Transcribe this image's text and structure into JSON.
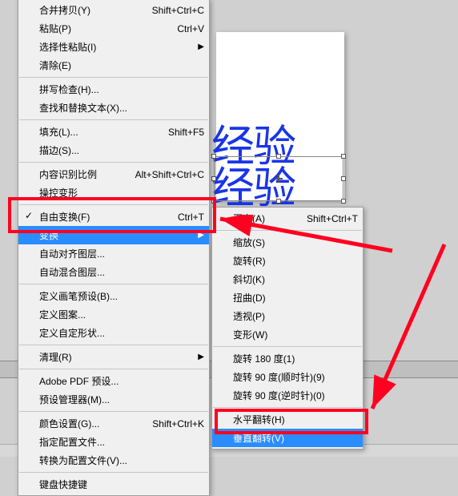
{
  "canvas": {
    "line1": "经验",
    "line2": "经验"
  },
  "menu1": {
    "copy_merge": {
      "label": "合并拷贝(Y)",
      "shortcut": "Shift+Ctrl+C"
    },
    "paste": {
      "label": "粘贴(P)",
      "shortcut": "Ctrl+V"
    },
    "paste_special": {
      "label": "选择性粘贴(I)"
    },
    "clear": {
      "label": "清除(E)"
    },
    "spellcheck": {
      "label": "拼写检查(H)..."
    },
    "find_replace": {
      "label": "查找和替换文本(X)..."
    },
    "fill": {
      "label": "填充(L)...",
      "shortcut": "Shift+F5"
    },
    "stroke": {
      "label": "描边(S)..."
    },
    "content_scale": {
      "label": "内容识别比例",
      "shortcut": "Alt+Shift+Ctrl+C"
    },
    "puppet": {
      "label": "操控变形"
    },
    "free_trans": {
      "label": "自由变换(F)",
      "shortcut": "Ctrl+T"
    },
    "transform": {
      "label": "变换"
    },
    "auto_align": {
      "label": "自动对齐图层..."
    },
    "auto_blend": {
      "label": "自动混合图层..."
    },
    "define_brush": {
      "label": "定义画笔预设(B)..."
    },
    "define_pat": {
      "label": "定义图案..."
    },
    "define_shape": {
      "label": "定义自定形状..."
    },
    "purge": {
      "label": "清理(R)"
    },
    "adobe_pdf": {
      "label": "Adobe PDF 预设..."
    },
    "preset_mgr": {
      "label": "预设管理器(M)..."
    },
    "color_set": {
      "label": "颜色设置(G)...",
      "shortcut": "Shift+Ctrl+K"
    },
    "assign_prof": {
      "label": "指定配置文件..."
    },
    "convert_prof": {
      "label": "转换为配置文件(V)..."
    },
    "kbd_shortcut": {
      "label": "键盘快捷键"
    }
  },
  "menu2": {
    "again": {
      "label": "再次(A)",
      "shortcut": "Shift+Ctrl+T"
    },
    "scale": {
      "label": "缩放(S)"
    },
    "rotate": {
      "label": "旋转(R)"
    },
    "skew": {
      "label": "斜切(K)"
    },
    "distort": {
      "label": "扭曲(D)"
    },
    "perspective": {
      "label": "透视(P)"
    },
    "warp": {
      "label": "变形(W)"
    },
    "rot180": {
      "label": "旋转 180 度(1)"
    },
    "rot90cw": {
      "label": "旋转 90 度(顺时针)(9)"
    },
    "rot90ccw": {
      "label": "旋转 90 度(逆时针)(0)"
    },
    "fliph": {
      "label": "水平翻转(H)"
    },
    "flipv": {
      "label": "垂直翻转(V)"
    }
  }
}
